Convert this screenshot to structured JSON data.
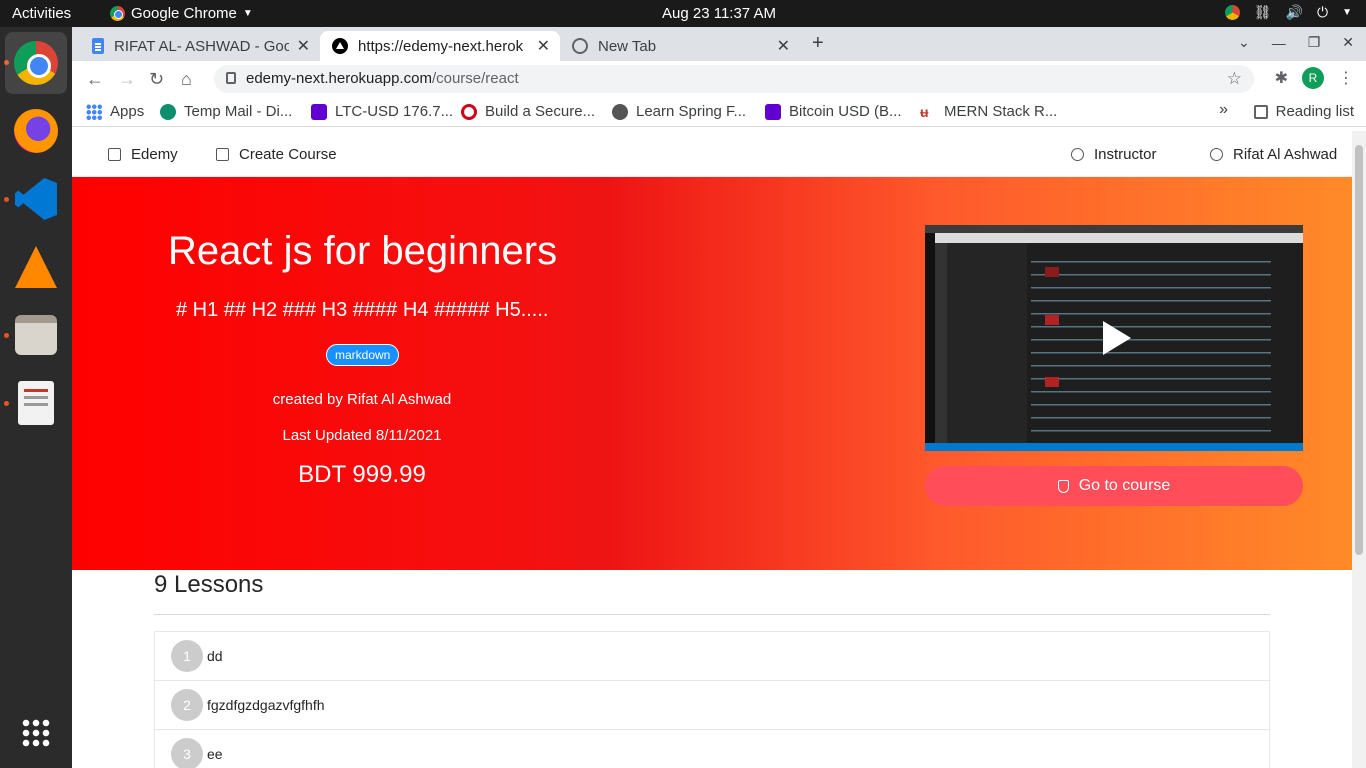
{
  "os": {
    "activities": "Activities",
    "app_name": "Google Chrome",
    "clock": "Aug 23  11:37 AM",
    "tray_icons": [
      "chrome-icon",
      "network-icon",
      "volume-icon",
      "power-icon"
    ],
    "dock": [
      "chrome",
      "firefox",
      "vscode",
      "vlc",
      "files",
      "document-viewer",
      "show-apps"
    ]
  },
  "browser": {
    "tabs": [
      {
        "title": "RIFAT AL- ASHWAD - Goog",
        "icon": "docs-icon"
      },
      {
        "title": "https://edemy-next.herok",
        "icon": "vercel-icon"
      },
      {
        "title": "New Tab",
        "icon": "globe-icon"
      }
    ],
    "url": {
      "host": "edemy-next.herokuapp.com",
      "path": "/course/react"
    },
    "profile_initial": "R",
    "bookmarks": [
      {
        "label": "Apps"
      },
      {
        "label": "Temp Mail - Di..."
      },
      {
        "label": "LTC-USD 176.7..."
      },
      {
        "label": "Build a Secure..."
      },
      {
        "label": "Learn Spring F..."
      },
      {
        "label": "Bitcoin USD (B..."
      },
      {
        "label": "MERN Stack R..."
      }
    ],
    "reading_list": "Reading list"
  },
  "site": {
    "nav": {
      "brand": "Edemy",
      "create_course": "Create Course",
      "instructor": "Instructor",
      "user": "Rifat Al Ashwad"
    },
    "course": {
      "title": "React js for beginners",
      "description": "# H1 ## H2 ### H3 #### H4 ##### H5.....",
      "category": "markdown",
      "author": "created by Rifat Al Ashwad",
      "updated": "Last Updated 8/11/2021",
      "price": "BDT 999.99",
      "cta": "Go to course"
    },
    "lessons": {
      "heading": "9 Lessons",
      "items": [
        {
          "num": "1",
          "title": "dd"
        },
        {
          "num": "2",
          "title": "fgzdfgzdgazvfgfhfh"
        },
        {
          "num": "3",
          "title": "ee"
        }
      ]
    }
  },
  "colors": {
    "hero_start": "#ff0000",
    "hero_end": "#ff8a28",
    "cta": "#ff4d5a",
    "badge": "#1890ff"
  }
}
